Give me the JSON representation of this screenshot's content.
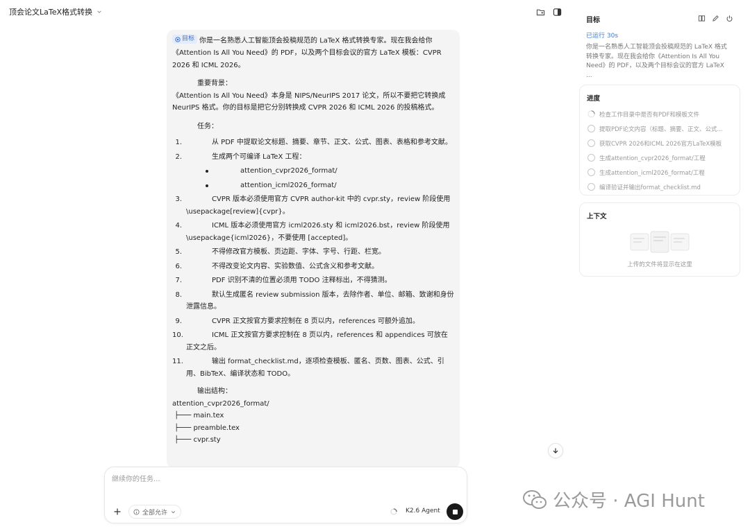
{
  "header": {
    "title": "顶会论文LaTeX格式转换"
  },
  "message": {
    "goal_tag": "目标",
    "intro": "你是一名熟悉人工智能顶会投稿规范的 LaTeX 格式转换专家。现在我会给你《Attention Is All You Need》的 PDF，以及两个目标会议的官方 LaTeX 模板：CVPR 2026 和 ICML 2026。",
    "background_title": "重要背景：",
    "background_text": "《Attention Is All You Need》本身是 NIPS/NeurIPS 2017 论文，所以不要把它转换成 NeurIPS 格式。你的目标是把它分别转换成 CVPR 2026 和 ICML 2026 的投稿格式。",
    "tasks_title": "任务：",
    "tasks": [
      {
        "num": "1.",
        "text": "从 PDF 中提取论文标题、摘要、章节、正文、公式、图表、表格和参考文献。"
      },
      {
        "num": "2.",
        "text": "生成两个可编译 LaTeX 工程：",
        "sub": [
          "attention_cvpr2026_format/",
          "attention_icml2026_format/"
        ]
      },
      {
        "num": "3.",
        "text": "CVPR 版本必须使用官方 CVPR author-kit 中的 cvpr.sty，review 阶段使用 \\usepackage[review]{cvpr}。"
      },
      {
        "num": "4.",
        "text": "ICML 版本必须使用官方 icml2026.sty 和 icml2026.bst，review 阶段使用 \\usepackage{icml2026}，不要使用 [accepted]。"
      },
      {
        "num": "5.",
        "text": "不得修改官方模板、页边距、字体、字号、行距、栏宽。"
      },
      {
        "num": "6.",
        "text": "不得改变论文内容、实验数值、公式含义和参考文献。"
      },
      {
        "num": "7.",
        "text": "PDF 识别不清的位置必须用 TODO 注释标出，不得猜测。"
      },
      {
        "num": "8.",
        "text": "默认生成匿名 review submission 版本，去除作者、单位、邮箱、致谢和身份泄露信息。"
      },
      {
        "num": "9.",
        "text": "CVPR 正文按官方要求控制在 8 页以内，references 可额外追加。"
      },
      {
        "num": "10.",
        "text": "ICML 正文按官方要求控制在 8 页以内，references 和 appendices 可放在正文之后。"
      },
      {
        "num": "11.",
        "text": "输出 format_checklist.md，逐项检查模板、匿名、页数、图表、公式、引用、BibTeX、编译状态和 TODO。"
      }
    ],
    "output_title": "输出结构：",
    "tree": [
      "attention_cvpr2026_format/",
      " ├─── main.tex",
      " ├─── preamble.tex",
      " ├─── cvpr.sty"
    ]
  },
  "composer": {
    "placeholder": "继续你的任务...",
    "permission_label": "全部允许",
    "agent_label": "K2.6 Agent"
  },
  "right_panel": {
    "goal_header": "目标",
    "running_status": "已运行 30s",
    "goal_desc": "你是一名熟悉人工智能顶会投稿规范的 LaTeX 格式转换专家。现在我会给你《Attention Is All You Need》的 PDF，以及两个目标会议的官方 LaTeX ...",
    "progress_header": "进度",
    "steps": [
      {
        "label": "检查工作目录中是否有PDF和模板文件",
        "state": "running"
      },
      {
        "label": "提取PDF论文内容（标题、摘要、正文、公式...",
        "state": "pending"
      },
      {
        "label": "获取CVPR 2026和ICML 2026官方LaTeX模板",
        "state": "pending"
      },
      {
        "label": "生成attention_cvpr2026_format/工程",
        "state": "pending"
      },
      {
        "label": "生成attention_icml2026_format/工程",
        "state": "pending"
      },
      {
        "label": "编译验证并输出format_checklist.md",
        "state": "pending"
      }
    ],
    "context_header": "上下文",
    "context_empty": "上传的文件将显示在这里"
  },
  "watermark": {
    "text": "公众号 · AGI Hunt"
  },
  "colors": {
    "accent": "#3b7bdc",
    "message_bg": "#f4f4f5",
    "stop_button": "#1a1a1a"
  }
}
